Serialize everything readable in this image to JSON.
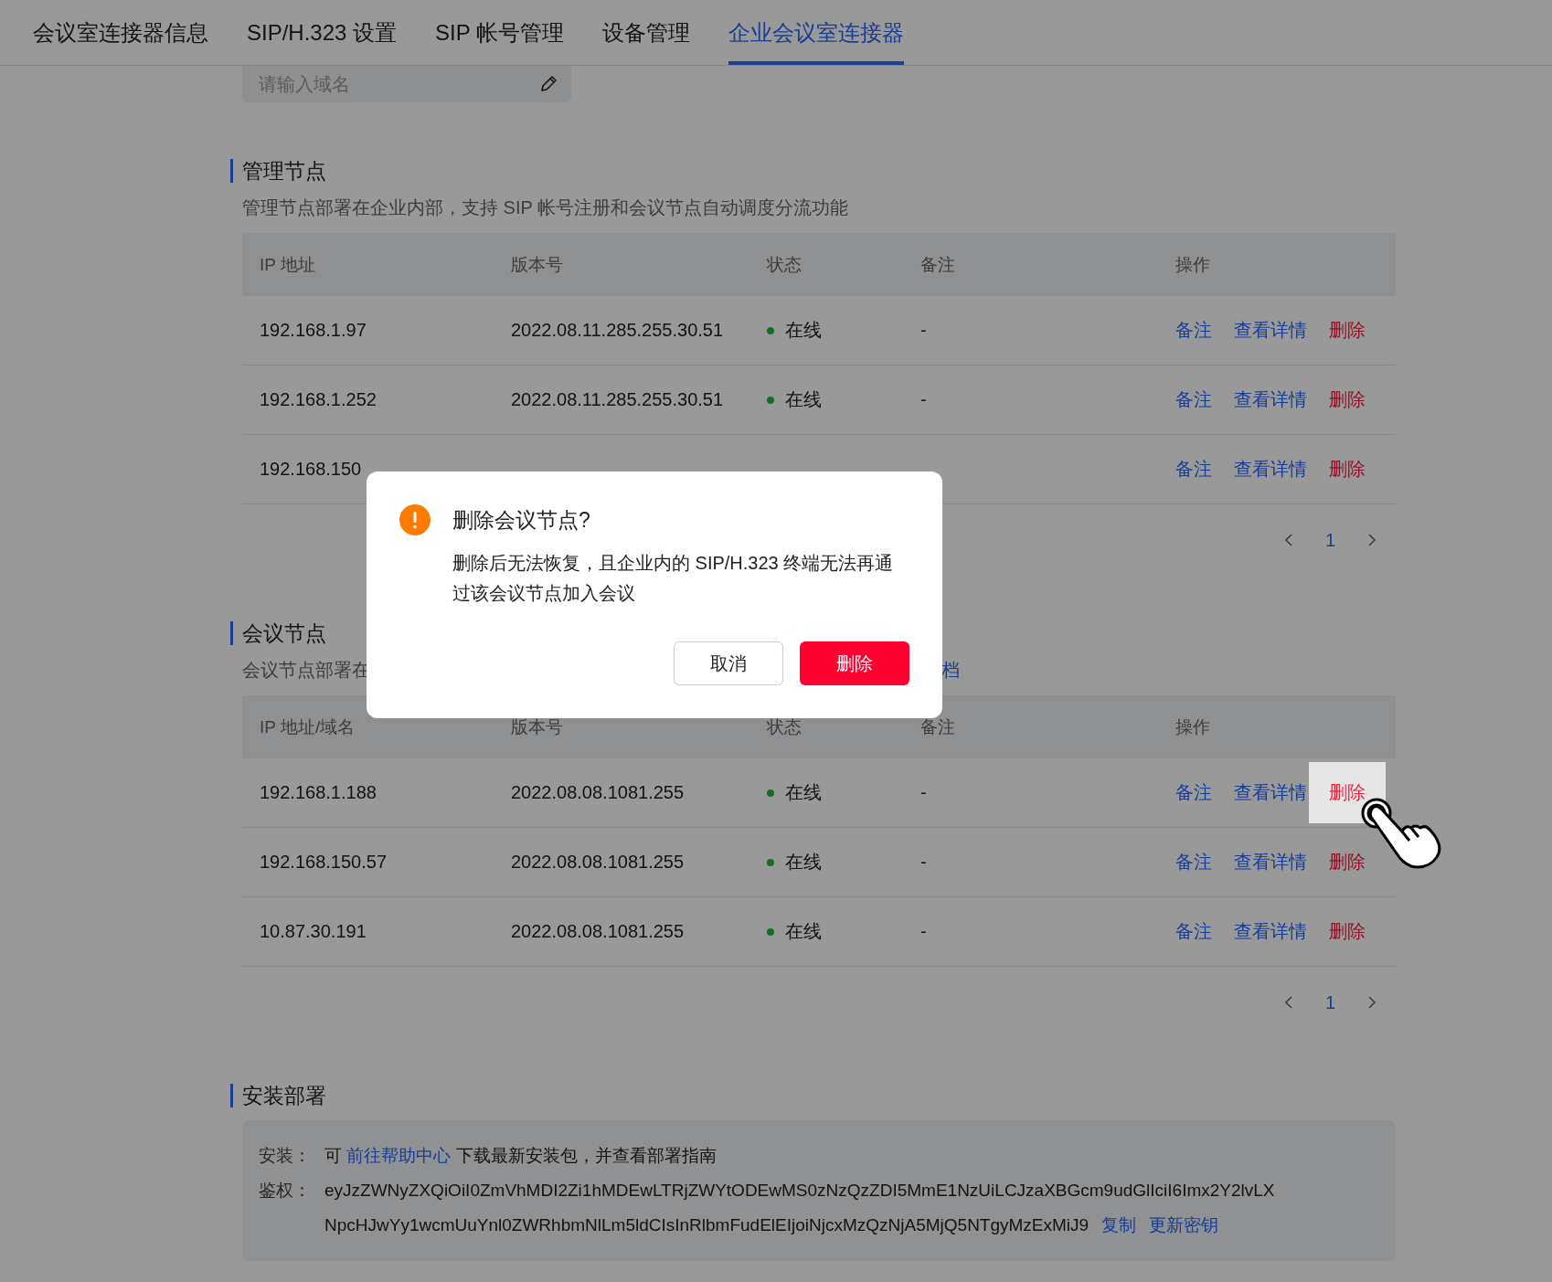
{
  "tabs": [
    {
      "label": "会议室连接器信息",
      "selected": false
    },
    {
      "label": "SIP/H.323 设置",
      "selected": false
    },
    {
      "label": "SIP 帐号管理",
      "selected": false
    },
    {
      "label": "设备管理",
      "selected": false
    },
    {
      "label": "企业会议室连接器",
      "selected": true
    }
  ],
  "domain_field": {
    "placeholder": "请输入域名"
  },
  "sections": [
    {
      "title": "管理节点",
      "description": "管理节点部署在企业内部，支持 SIP 帐号注册和会议节点自动调度分流功能",
      "table": {
        "columns": [
          "IP 地址",
          "版本号",
          "状态",
          "备注",
          "操作"
        ],
        "rows": [
          {
            "ip": "192.168.1.97",
            "version": "2022.08.11.285.255.30.51",
            "status": "在线",
            "note": "-",
            "actions": [
              {
                "label": "备注",
                "kind": "link",
                "highlighted": false
              },
              {
                "label": "查看详情",
                "kind": "link",
                "highlighted": false
              },
              {
                "label": "删除",
                "kind": "danger",
                "highlighted": false
              }
            ]
          },
          {
            "ip": "192.168.1.252",
            "version": "2022.08.11.285.255.30.51",
            "status": "在线",
            "note": "-",
            "actions": [
              {
                "label": "备注",
                "kind": "link",
                "highlighted": false
              },
              {
                "label": "查看详情",
                "kind": "link",
                "highlighted": false
              },
              {
                "label": "删除",
                "kind": "danger",
                "highlighted": false
              }
            ]
          },
          {
            "ip": "192.168.150",
            "actions": [
              {
                "label": "备注",
                "kind": "link",
                "highlighted": false
              },
              {
                "label": "查看详情",
                "kind": "link",
                "highlighted": false
              },
              {
                "label": "删除",
                "kind": "danger",
                "highlighted": false
              }
            ]
          }
        ]
      },
      "pagination": {
        "pages": [
          {
            "label": "1",
            "selected": true
          }
        ]
      }
    },
    {
      "title": "会议节点",
      "description": "会议节点部署在",
      "description_link": "档",
      "table": {
        "columns": [
          "IP 地址/域名",
          "版本号",
          "状态",
          "备注",
          "操作"
        ],
        "rows": [
          {
            "ip": "192.168.1.188",
            "version": "2022.08.08.1081.255",
            "status": "在线",
            "note": "-",
            "actions": [
              {
                "label": "备注",
                "kind": "link",
                "highlighted": false
              },
              {
                "label": "查看详情",
                "kind": "link",
                "highlighted": false
              },
              {
                "label": "删除",
                "kind": "danger",
                "highlighted": true
              }
            ]
          },
          {
            "ip": "192.168.150.57",
            "version": "2022.08.08.1081.255",
            "status": "在线",
            "note": "-",
            "actions": [
              {
                "label": "备注",
                "kind": "link",
                "highlighted": false
              },
              {
                "label": "查看详情",
                "kind": "link",
                "highlighted": false
              },
              {
                "label": "删除",
                "kind": "danger",
                "highlighted": false
              }
            ]
          },
          {
            "ip": "10.87.30.191",
            "version": "2022.08.08.1081.255",
            "status": "在线",
            "note": "-",
            "actions": [
              {
                "label": "备注",
                "kind": "link",
                "highlighted": false
              },
              {
                "label": "查看详情",
                "kind": "link",
                "highlighted": false
              },
              {
                "label": "删除",
                "kind": "danger",
                "highlighted": false
              }
            ]
          }
        ]
      },
      "pagination": {
        "pages": [
          {
            "label": "1",
            "selected": true
          }
        ]
      }
    }
  ],
  "install": {
    "title": "安装部署",
    "install_label": "安装：",
    "install_before": "可 ",
    "install_link": "前往帮助中心",
    "install_after": " 下载最新安装包，并查看部署指南",
    "auth_label": "鉴权：",
    "auth_token_lines": [
      "eyJzZWNyZXQiOiI0ZmVhMDI2Zi1hMDEwLTRjZWYtODEwMS0zNzQzZDI5MmE1NzUiLCJzaXBGcm9udGlIciI6Imx2Y2lvLX",
      "NpcHJwYy1wcmUuYnl0ZWRhbmNlLm5ldCIsInRlbmFudElEIjoiNjcxMzQzNjA5MjQ5NTgyMzExMiJ9"
    ],
    "auth_links": [
      "复制",
      "更新密钥"
    ]
  },
  "dialog": {
    "title": "删除会议节点?",
    "message": "删除后无法恢复，且企业内的 SIP/H.323 终端无法再通过该会议节点加入会议",
    "buttons": [
      {
        "label": "取消",
        "kind": "secondary"
      },
      {
        "label": "删除",
        "kind": "primary"
      }
    ]
  }
}
